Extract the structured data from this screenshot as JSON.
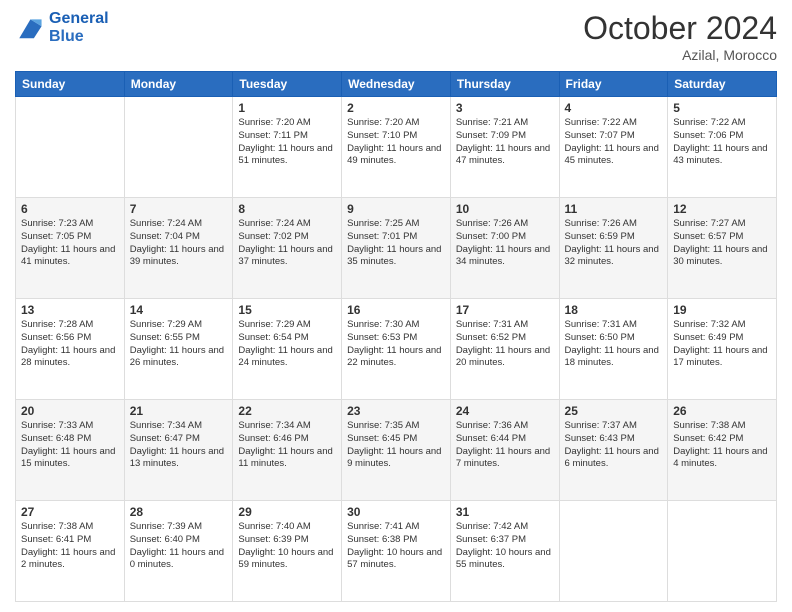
{
  "header": {
    "logo_line1": "General",
    "logo_line2": "Blue",
    "month_year": "October 2024",
    "location": "Azilal, Morocco"
  },
  "weekdays": [
    "Sunday",
    "Monday",
    "Tuesday",
    "Wednesday",
    "Thursday",
    "Friday",
    "Saturday"
  ],
  "weeks": [
    [
      {
        "day": "",
        "sunrise": "",
        "sunset": "",
        "daylight": ""
      },
      {
        "day": "",
        "sunrise": "",
        "sunset": "",
        "daylight": ""
      },
      {
        "day": "1",
        "sunrise": "Sunrise: 7:20 AM",
        "sunset": "Sunset: 7:11 PM",
        "daylight": "Daylight: 11 hours and 51 minutes."
      },
      {
        "day": "2",
        "sunrise": "Sunrise: 7:20 AM",
        "sunset": "Sunset: 7:10 PM",
        "daylight": "Daylight: 11 hours and 49 minutes."
      },
      {
        "day": "3",
        "sunrise": "Sunrise: 7:21 AM",
        "sunset": "Sunset: 7:09 PM",
        "daylight": "Daylight: 11 hours and 47 minutes."
      },
      {
        "day": "4",
        "sunrise": "Sunrise: 7:22 AM",
        "sunset": "Sunset: 7:07 PM",
        "daylight": "Daylight: 11 hours and 45 minutes."
      },
      {
        "day": "5",
        "sunrise": "Sunrise: 7:22 AM",
        "sunset": "Sunset: 7:06 PM",
        "daylight": "Daylight: 11 hours and 43 minutes."
      }
    ],
    [
      {
        "day": "6",
        "sunrise": "Sunrise: 7:23 AM",
        "sunset": "Sunset: 7:05 PM",
        "daylight": "Daylight: 11 hours and 41 minutes."
      },
      {
        "day": "7",
        "sunrise": "Sunrise: 7:24 AM",
        "sunset": "Sunset: 7:04 PM",
        "daylight": "Daylight: 11 hours and 39 minutes."
      },
      {
        "day": "8",
        "sunrise": "Sunrise: 7:24 AM",
        "sunset": "Sunset: 7:02 PM",
        "daylight": "Daylight: 11 hours and 37 minutes."
      },
      {
        "day": "9",
        "sunrise": "Sunrise: 7:25 AM",
        "sunset": "Sunset: 7:01 PM",
        "daylight": "Daylight: 11 hours and 35 minutes."
      },
      {
        "day": "10",
        "sunrise": "Sunrise: 7:26 AM",
        "sunset": "Sunset: 7:00 PM",
        "daylight": "Daylight: 11 hours and 34 minutes."
      },
      {
        "day": "11",
        "sunrise": "Sunrise: 7:26 AM",
        "sunset": "Sunset: 6:59 PM",
        "daylight": "Daylight: 11 hours and 32 minutes."
      },
      {
        "day": "12",
        "sunrise": "Sunrise: 7:27 AM",
        "sunset": "Sunset: 6:57 PM",
        "daylight": "Daylight: 11 hours and 30 minutes."
      }
    ],
    [
      {
        "day": "13",
        "sunrise": "Sunrise: 7:28 AM",
        "sunset": "Sunset: 6:56 PM",
        "daylight": "Daylight: 11 hours and 28 minutes."
      },
      {
        "day": "14",
        "sunrise": "Sunrise: 7:29 AM",
        "sunset": "Sunset: 6:55 PM",
        "daylight": "Daylight: 11 hours and 26 minutes."
      },
      {
        "day": "15",
        "sunrise": "Sunrise: 7:29 AM",
        "sunset": "Sunset: 6:54 PM",
        "daylight": "Daylight: 11 hours and 24 minutes."
      },
      {
        "day": "16",
        "sunrise": "Sunrise: 7:30 AM",
        "sunset": "Sunset: 6:53 PM",
        "daylight": "Daylight: 11 hours and 22 minutes."
      },
      {
        "day": "17",
        "sunrise": "Sunrise: 7:31 AM",
        "sunset": "Sunset: 6:52 PM",
        "daylight": "Daylight: 11 hours and 20 minutes."
      },
      {
        "day": "18",
        "sunrise": "Sunrise: 7:31 AM",
        "sunset": "Sunset: 6:50 PM",
        "daylight": "Daylight: 11 hours and 18 minutes."
      },
      {
        "day": "19",
        "sunrise": "Sunrise: 7:32 AM",
        "sunset": "Sunset: 6:49 PM",
        "daylight": "Daylight: 11 hours and 17 minutes."
      }
    ],
    [
      {
        "day": "20",
        "sunrise": "Sunrise: 7:33 AM",
        "sunset": "Sunset: 6:48 PM",
        "daylight": "Daylight: 11 hours and 15 minutes."
      },
      {
        "day": "21",
        "sunrise": "Sunrise: 7:34 AM",
        "sunset": "Sunset: 6:47 PM",
        "daylight": "Daylight: 11 hours and 13 minutes."
      },
      {
        "day": "22",
        "sunrise": "Sunrise: 7:34 AM",
        "sunset": "Sunset: 6:46 PM",
        "daylight": "Daylight: 11 hours and 11 minutes."
      },
      {
        "day": "23",
        "sunrise": "Sunrise: 7:35 AM",
        "sunset": "Sunset: 6:45 PM",
        "daylight": "Daylight: 11 hours and 9 minutes."
      },
      {
        "day": "24",
        "sunrise": "Sunrise: 7:36 AM",
        "sunset": "Sunset: 6:44 PM",
        "daylight": "Daylight: 11 hours and 7 minutes."
      },
      {
        "day": "25",
        "sunrise": "Sunrise: 7:37 AM",
        "sunset": "Sunset: 6:43 PM",
        "daylight": "Daylight: 11 hours and 6 minutes."
      },
      {
        "day": "26",
        "sunrise": "Sunrise: 7:38 AM",
        "sunset": "Sunset: 6:42 PM",
        "daylight": "Daylight: 11 hours and 4 minutes."
      }
    ],
    [
      {
        "day": "27",
        "sunrise": "Sunrise: 7:38 AM",
        "sunset": "Sunset: 6:41 PM",
        "daylight": "Daylight: 11 hours and 2 minutes."
      },
      {
        "day": "28",
        "sunrise": "Sunrise: 7:39 AM",
        "sunset": "Sunset: 6:40 PM",
        "daylight": "Daylight: 11 hours and 0 minutes."
      },
      {
        "day": "29",
        "sunrise": "Sunrise: 7:40 AM",
        "sunset": "Sunset: 6:39 PM",
        "daylight": "Daylight: 10 hours and 59 minutes."
      },
      {
        "day": "30",
        "sunrise": "Sunrise: 7:41 AM",
        "sunset": "Sunset: 6:38 PM",
        "daylight": "Daylight: 10 hours and 57 minutes."
      },
      {
        "day": "31",
        "sunrise": "Sunrise: 7:42 AM",
        "sunset": "Sunset: 6:37 PM",
        "daylight": "Daylight: 10 hours and 55 minutes."
      },
      {
        "day": "",
        "sunrise": "",
        "sunset": "",
        "daylight": ""
      },
      {
        "day": "",
        "sunrise": "",
        "sunset": "",
        "daylight": ""
      }
    ]
  ]
}
